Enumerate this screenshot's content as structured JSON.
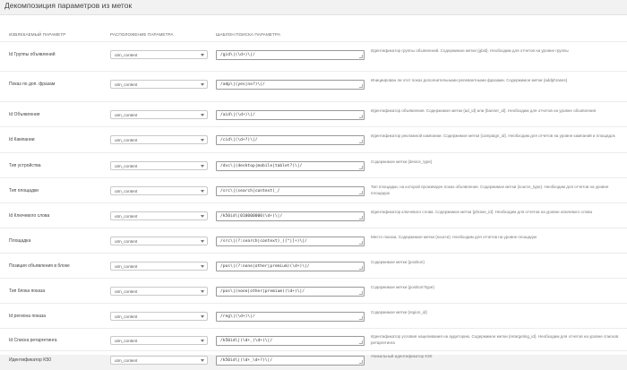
{
  "page": {
    "title": "Декомпозиция параметров из меток"
  },
  "headers": {
    "param": "ИЗВЛЕКАЕМЫЙ ПАРАМЕТР",
    "location": "РАСПОЛОЖЕНИЕ ПАРАМЕТРА",
    "pattern": "ШАБЛОН ПОИСКА ПАРАМЕТРА"
  },
  "rows": [
    {
      "label": "Id Группы объявлений",
      "location": "utm_content",
      "pattern": "/gid\\|(\\d+)\\|/",
      "desc": "Идентификатор группы объявлений. Содержимое метки {gbid}. Необходим для отчетов на уровне группы"
    },
    {
      "label": "Показ по доп. фразам",
      "location": "utm_content",
      "pattern": "/adp\\|(yes|no?)\\|/",
      "desc": "Инициирован ли этот показ дополнительными релевантными фразами. Содержимое метки {addphrases}"
    },
    {
      "label": "Id Объявления",
      "location": "utm_content",
      "pattern": "/aid\\|(\\d+)\\|/",
      "desc": "Идентификатор объявления. Содержимое метки {ad_id} или {banner_id}. Необходим для отчетов на уровне объявления"
    },
    {
      "label": "Id Кампании",
      "location": "utm_content",
      "pattern": "/cid\\|(\\d+?)\\|/",
      "desc": "Идентификатор рекламной кампании. Содержимое метки {campaign_id}. Необходим для отчетов на уровне кампаний и площадок"
    },
    {
      "label": "Тип устройства",
      "location": "utm_content",
      "pattern": "/dvc\\|(desktop|mobile|tablet?)\\|/",
      "desc": "Содержимое метки {device_type}"
    },
    {
      "label": "Тип площадки",
      "location": "utm_content",
      "pattern": "/src\\|(search|context)_/",
      "desc": "Тип площадки, на которой произведен показ объявления. Содержимое метки {source_type}. Необходим для отчетов на уровне площадок"
    },
    {
      "label": "Id Ключевого слова",
      "location": "utm_content",
      "pattern": "/k50id\\|010000000(\\d+)\\|/",
      "desc": "Идентификатор ключевого слова. Содержимое метки {phrase_id}. Необходим для отчетов на уровне ключевого слова"
    },
    {
      "label": "Площадка",
      "location": "utm_content",
      "pattern": "/src\\|(?:search|context)_([^|]+)\\|/",
      "desc": "Место показа. Содержимое метки {source}. Необходим для отчетов на уровне площадок"
    },
    {
      "label": "Позиция объявления в блоке",
      "location": "utm_content",
      "pattern": "/pos\\|(?:none|other|premium)(\\d+)\\|/",
      "desc": "Содержимое метки {position}"
    },
    {
      "label": "Тип блока показа",
      "location": "utm_content",
      "pattern": "/pos\\|(none|other|premium)(\\d+)\\|/",
      "desc": "Содержимое метки {position?type}"
    },
    {
      "label": "Id региона показа",
      "location": "utm_content",
      "pattern": "/reg\\|(\\d+)\\|/",
      "desc": "Содержимое метки {region_id}"
    },
    {
      "label": "Id Списка ретаргетинга",
      "location": "utm_content",
      "pattern": "/k50id\\|(\\d+_(\\d+)\\|/",
      "desc": "Идентификатор условия нацеливания на аудиторию. Содержимое метки {retargeting_id}. Необходим для отчетов на уровне списков ретаргетинга"
    },
    {
      "label": "Идентификатор K50",
      "location": "utm_content",
      "pattern": "/k50id\\|(\\d+_\\d+?)\\|/",
      "desc": "Уникальный идентификатор K50"
    }
  ]
}
